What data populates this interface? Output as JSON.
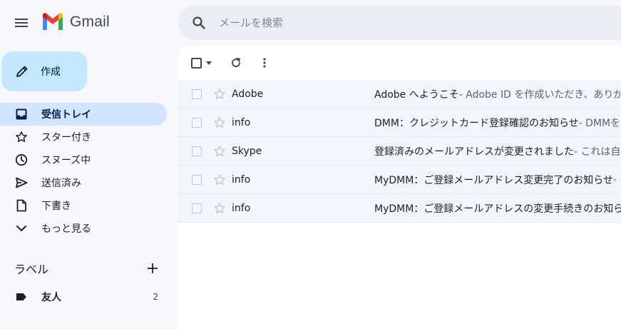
{
  "app": {
    "name": "Gmail"
  },
  "search": {
    "placeholder": "メールを検索"
  },
  "compose": {
    "label": "作成"
  },
  "nav": {
    "items": [
      {
        "label": "受信トレイ",
        "icon": "inbox-icon",
        "active": true
      },
      {
        "label": "スター付き",
        "icon": "star-icon"
      },
      {
        "label": "スヌーズ中",
        "icon": "clock-icon"
      },
      {
        "label": "送信済み",
        "icon": "send-icon"
      },
      {
        "label": "下書き",
        "icon": "draft-icon"
      },
      {
        "label": "もっと見る",
        "icon": "chevron-down-icon"
      }
    ]
  },
  "labels": {
    "title": "ラベル",
    "items": [
      {
        "name": "友人",
        "count": "2",
        "icon": "label-icon"
      }
    ]
  },
  "emails": [
    {
      "sender": "Adobe",
      "subject": "Adobe へようこそ",
      "snippet": " - Adobe ID を作成いただき、ありがとうございます"
    },
    {
      "sender": "info",
      "subject": "DMM：クレジットカード登録確認のお知らせ",
      "snippet": " - DMMをご利用いただき"
    },
    {
      "sender": "Skype",
      "subject": "登録済みのメールアドレスが変更されました",
      "snippet": " - これは自動送信メールです"
    },
    {
      "sender": "info",
      "subject": "MyDMM：ご登録メールアドレス変更完了のお知らせ",
      "snippet": " - "
    },
    {
      "sender": "info",
      "subject": "MyDMM：ご登録メールアドレスの変更手続きのお知らせ",
      "snippet": ""
    }
  ],
  "colors": {
    "background": "#f6f8fc",
    "compose": "#c2e7ff",
    "active_nav": "#d3e3fd",
    "search_bg": "#e9eef6",
    "row_bg": "#f2f6fc"
  }
}
